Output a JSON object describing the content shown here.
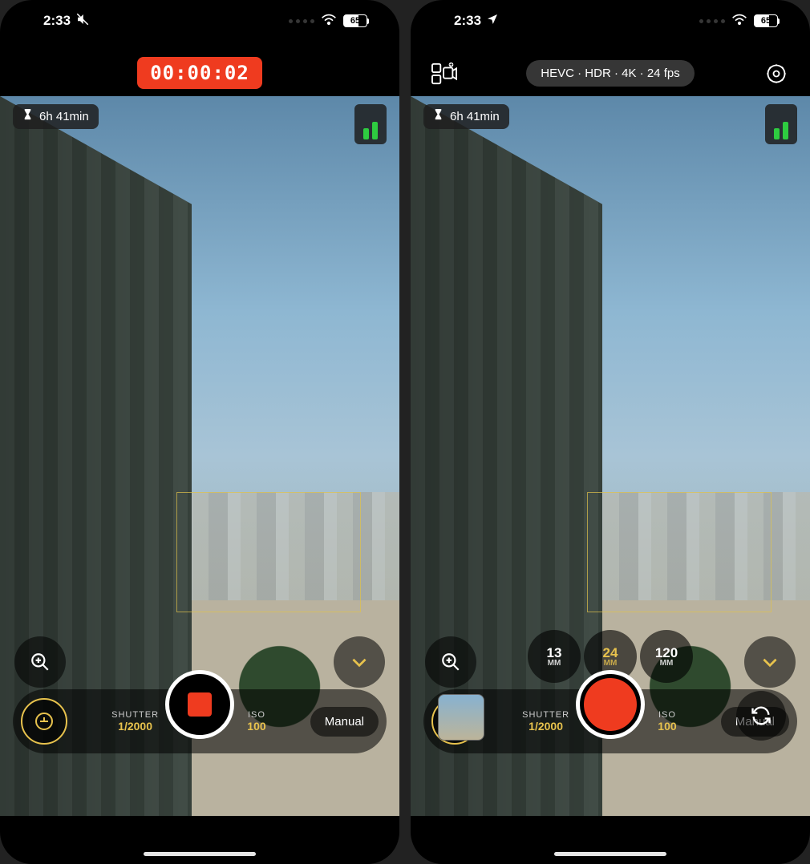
{
  "left": {
    "status": {
      "time": "2:33",
      "battery": "65"
    },
    "header": {
      "recording_time": "00:00:02"
    },
    "viewfinder": {
      "time_remaining": "6h 41min"
    },
    "exposure": {
      "shutter_label": "SHUTTER",
      "shutter_value": "1/2000",
      "iso_label": "ISO",
      "iso_value": "100",
      "mode": "Manual"
    }
  },
  "right": {
    "status": {
      "time": "2:33",
      "battery": "65"
    },
    "header": {
      "format": "HEVC",
      "dynamic_range": "HDR",
      "resolution": "4K",
      "framerate": "24 fps"
    },
    "viewfinder": {
      "time_remaining": "6h 41min"
    },
    "lenses": [
      {
        "focal": "13",
        "unit": "MM",
        "active": false
      },
      {
        "focal": "24",
        "unit": "MM",
        "active": true
      },
      {
        "focal": "120",
        "unit": "MM",
        "active": false
      }
    ],
    "exposure": {
      "shutter_label": "SHUTTER",
      "shutter_value": "1/2000",
      "iso_label": "ISO",
      "iso_value": "100",
      "mode": "Manual"
    }
  }
}
